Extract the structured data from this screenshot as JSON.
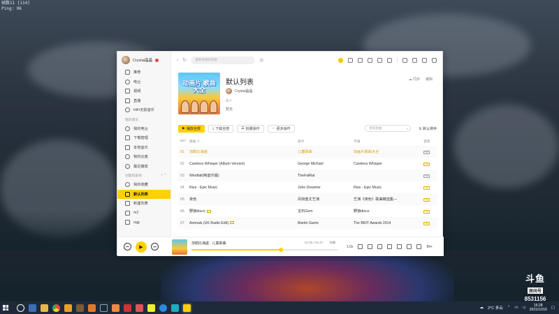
{
  "hud": {
    "line1": "帧数11  [114]",
    "line2": "Ping:  96"
  },
  "sidebar": {
    "user_name": "Crystal晶晶",
    "items": [
      {
        "label": "推荐",
        "icon": "home-icon"
      },
      {
        "label": "电台",
        "icon": "radio-icon"
      },
      {
        "label": "视频",
        "icon": "video-icon"
      },
      {
        "label": "直播",
        "icon": "live-icon"
      },
      {
        "label": "HiFi无损音乐",
        "icon": "hifi-icon"
      }
    ],
    "section_my": "我的音乐",
    "my_items": [
      {
        "label": "我的电台",
        "icon": "my-radio-icon"
      },
      {
        "label": "下载管理",
        "icon": "download-icon"
      },
      {
        "label": "本地音乐",
        "icon": "local-music-icon"
      },
      {
        "label": "我的云盘",
        "icon": "cloud-icon"
      },
      {
        "label": "最近播放",
        "icon": "recent-icon"
      }
    ],
    "section_created": "创建的歌单",
    "playlists": [
      {
        "label": "我的收藏",
        "icon": "heart-icon",
        "active": false
      },
      {
        "label": "默认列表",
        "icon": "speaker-icon",
        "active": true
      },
      {
        "label": "新建列表",
        "icon": "list-icon",
        "active": false
      },
      {
        "label": "m2",
        "icon": "list-icon",
        "active": false
      },
      {
        "label": "ogg",
        "icon": "list-icon",
        "active": false
      }
    ]
  },
  "topbar": {
    "search_placeholder": "搜索你想听的歌"
  },
  "playlist": {
    "cover_title": "动画片 歌曲大全",
    "title": "默认列表",
    "owner": "Crystal晶晶",
    "label": "简介",
    "tag": "暂无",
    "sync": "同步",
    "edit": "编辑"
  },
  "toolbar": {
    "play_all": "播放全部",
    "download": "下载全部",
    "batch": "批量操作",
    "more": "更多操作",
    "search_placeholder": "搜索歌曲",
    "sort": "默认排序"
  },
  "table": {
    "count": "507",
    "headers": {
      "name": "歌曲",
      "artist": "歌手",
      "album": "专辑",
      "quality": "音质"
    },
    "rows": [
      {
        "num": "01",
        "name": "加勒比海盗",
        "artist": "儿童歌曲",
        "album": "动画片歌曲大全",
        "quality": "SQ",
        "playing": true
      },
      {
        "num": "02",
        "name": "Careless Whisper (Album Version)",
        "artist": "George Michael",
        "album": "Careless Whisper",
        "quality": "HQ",
        "playing": false
      },
      {
        "num": "03",
        "name": "Windfall(纯音乐版)",
        "artist": "TheFatRat",
        "album": "",
        "quality": "SQ",
        "playing": false
      },
      {
        "num": "04",
        "name": "Rise - Epic Music",
        "artist": "John Dreamer",
        "album": "Rise - Epic Music",
        "quality": "HQ",
        "playing": false
      },
      {
        "num": "05",
        "name": "夜色",
        "artist": "凤钗叁丈艺演",
        "album": "艺演《夜色》歌曲精选集—",
        "quality": "HQ",
        "playing": false
      },
      {
        "num": "06",
        "name": "野狼disco",
        "artist": "宝石Gem",
        "album": "野狼disco",
        "quality": "HQ",
        "playing": false,
        "mv": true
      },
      {
        "num": "07",
        "name": "Animals (UK Radio Edit)",
        "artist": "Martin Garrix",
        "album": "The BRIT Awards 2014",
        "quality": "HQ",
        "playing": false,
        "mv": true
      }
    ]
  },
  "playbar": {
    "now_playing": "加勒比海盗 - 儿童歌曲",
    "time": "01:05 / 01:47",
    "lyric": "词曲",
    "progress": 0.61,
    "speed": "1.0x",
    "count": "99+"
  },
  "taskbar": {
    "weather": "2°C 多云",
    "time": "16:28",
    "date": "2021/12/16"
  },
  "watermark": {
    "logo": "斗鱼",
    "room_label": "房间号",
    "room_id": "8531156"
  },
  "colors": {
    "accent": "#ffd100",
    "active_text": "#d9a400"
  }
}
